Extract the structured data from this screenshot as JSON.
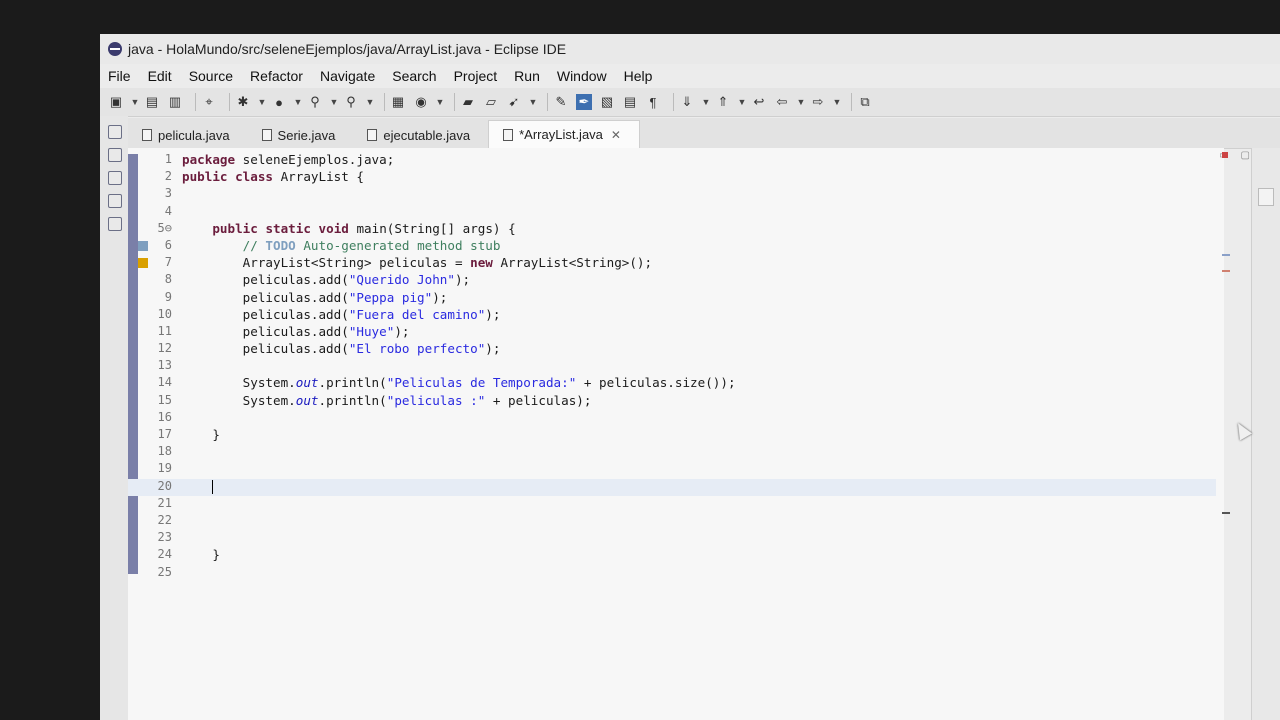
{
  "window": {
    "title": "java - HolaMundo/src/seleneEjemplos/java/ArrayList.java - Eclipse IDE"
  },
  "menu": [
    "File",
    "Edit",
    "Source",
    "Refactor",
    "Navigate",
    "Search",
    "Project",
    "Run",
    "Window",
    "Help"
  ],
  "tabs": [
    {
      "label": "pelicula.java",
      "active": false
    },
    {
      "label": "Serie.java",
      "active": false
    },
    {
      "label": "ejecutable.java",
      "active": false
    },
    {
      "label": "*ArrayList.java",
      "active": true
    }
  ],
  "tab_close_glyph": "✕",
  "editor": {
    "lines": [
      {
        "n": "1",
        "text": "package seleneEjemplos.java;"
      },
      {
        "n": "2",
        "text": "public class ArrayList {"
      },
      {
        "n": "3",
        "text": ""
      },
      {
        "n": "4",
        "text": ""
      },
      {
        "n": "5⊖",
        "text": "    public static void main(String[] args) {"
      },
      {
        "n": "6",
        "text": "        // TODO Auto-generated method stub"
      },
      {
        "n": "7",
        "text": "        ArrayList<String> peliculas = new ArrayList<String>();"
      },
      {
        "n": "8",
        "text": "        peliculas.add(\"Querido John\");"
      },
      {
        "n": "9",
        "text": "        peliculas.add(\"Peppa pig\");"
      },
      {
        "n": "10",
        "text": "        peliculas.add(\"Fuera del camino\");"
      },
      {
        "n": "11",
        "text": "        peliculas.add(\"Huye\");"
      },
      {
        "n": "12",
        "text": "        peliculas.add(\"El robo perfecto\");"
      },
      {
        "n": "13",
        "text": ""
      },
      {
        "n": "14",
        "text": "        System.out.println(\"Peliculas de Temporada:\" + peliculas.size());"
      },
      {
        "n": "15",
        "text": "        System.out.println(\"peliculas :\" + peliculas);"
      },
      {
        "n": "16",
        "text": ""
      },
      {
        "n": "17",
        "text": "    }"
      },
      {
        "n": "18",
        "text": ""
      },
      {
        "n": "19",
        "text": ""
      },
      {
        "n": "20",
        "text": "",
        "current": true
      },
      {
        "n": "21",
        "text": ""
      },
      {
        "n": "22",
        "text": ""
      },
      {
        "n": "23",
        "text": ""
      },
      {
        "n": "24",
        "text": "    }"
      },
      {
        "n": "25",
        "text": ""
      }
    ]
  },
  "colors": {
    "keyword": "#6b1d3d",
    "string": "#2a2ae0",
    "comment": "#3f7f5f",
    "gutter_bar": "#7a7fa8",
    "current_line": "#e6ecf5"
  },
  "toolbar_icons": [
    "new-icon",
    "save-icon",
    "save-all-icon",
    "print-icon",
    "debug-icon",
    "run-icon",
    "search-icon",
    "refactor-icon",
    "build-icon",
    "open-type-icon",
    "open-task-icon",
    "perspective-icon",
    "annotation-icon",
    "highlight-icon",
    "toggle-mark-icon",
    "block-select-icon",
    "whitespace-icon",
    "next-annotation-icon",
    "prev-annotation-icon",
    "back-icon",
    "forward-icon",
    "pin-icon"
  ]
}
